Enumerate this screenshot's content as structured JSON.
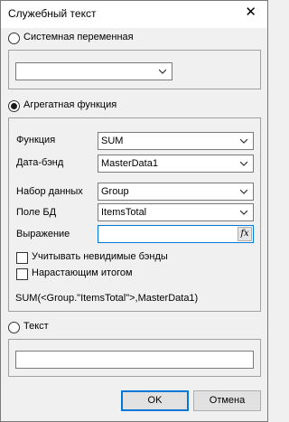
{
  "window": {
    "title": "Служебный текст",
    "close_symbol": "✕"
  },
  "system_var": {
    "label": "Системная переменная",
    "selected": false,
    "value": ""
  },
  "aggregate": {
    "label": "Агрегатная функция",
    "selected": true,
    "function_label": "Функция",
    "function_value": "SUM",
    "databand_label": "Дата-бэнд",
    "databand_value": "MasterData1",
    "dataset_label": "Набор данных",
    "dataset_value": "Group",
    "dbfield_label": "Поле БД",
    "dbfield_value": "ItemsTotal",
    "expression_label": "Выражение",
    "expression_value": "",
    "expression_button": "fx",
    "invisible_bands_label": "Учитывать невидимые бэнды",
    "invisible_bands_checked": false,
    "running_total_label": "Нарастающим итогом",
    "running_total_checked": false,
    "result_expr": "SUM(<Group.\"ItemsTotal\">,MasterData1)"
  },
  "text": {
    "label": "Текст",
    "selected": false,
    "value": ""
  },
  "buttons": {
    "ok": "OK",
    "cancel": "Отмена"
  }
}
